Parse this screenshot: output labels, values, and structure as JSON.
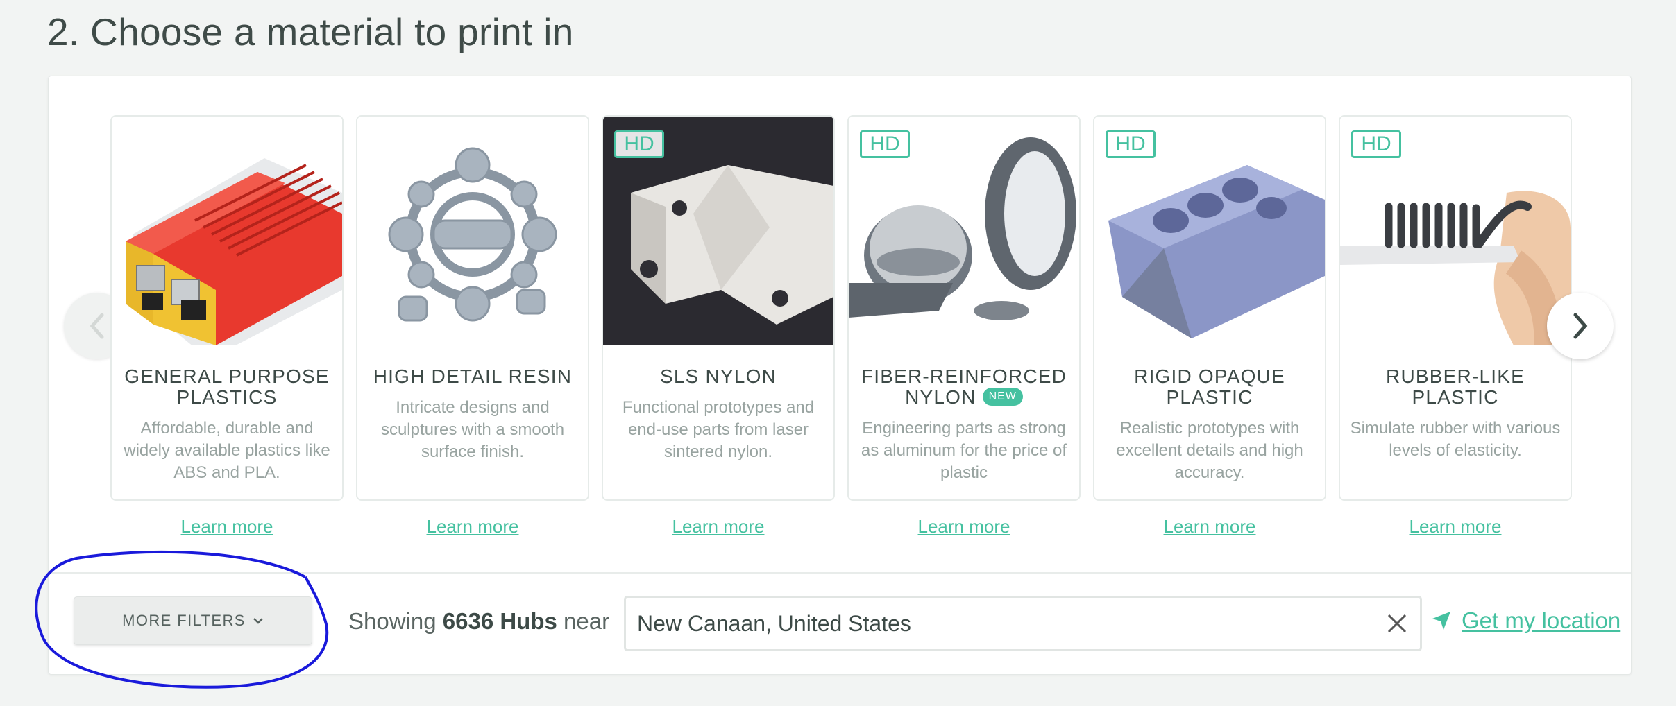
{
  "section": {
    "title": "2. Choose a material to print in"
  },
  "carousel": {
    "prev_icon": "chevron-left-icon",
    "next_icon": "chevron-right-icon",
    "materials": [
      {
        "name": "GENERAL PURPOSE PLASTICS",
        "hd": "",
        "is_new": false,
        "new_label": "",
        "description": "Affordable, durable and widely available plastics like ABS and PLA.",
        "link": "Learn more",
        "image": "red-plastic-case-image"
      },
      {
        "name": "HIGH DETAIL RESIN",
        "hd": "",
        "is_new": false,
        "new_label": "",
        "description": "Intricate designs and sculptures with a smooth surface finish.",
        "link": "Learn more",
        "image": "resin-gear-sculpture-image"
      },
      {
        "name": "SLS NYLON",
        "hd": "HD",
        "is_new": false,
        "new_label": "",
        "description": "Functional prototypes and end-use parts from laser sintered nylon.",
        "link": "Learn more",
        "image": "white-nylon-bracket-image"
      },
      {
        "name": "FIBER-REINFORCED NYLON",
        "hd": "HD",
        "is_new": true,
        "new_label": "NEW",
        "description": "Engineering parts as strong as aluminum for the price of plastic",
        "link": "Learn more",
        "image": "fiber-nylon-parts-image"
      },
      {
        "name": "RIGID OPAQUE PLASTIC",
        "hd": "HD",
        "is_new": false,
        "new_label": "",
        "description": "Realistic prototypes with excellent details and high accuracy.",
        "link": "Learn more",
        "image": "engine-block-image"
      },
      {
        "name": "RUBBER-LIKE PLASTIC",
        "hd": "HD",
        "is_new": false,
        "new_label": "",
        "description": "Simulate rubber with various levels of elasticity.",
        "link": "Learn more",
        "image": "rubber-brush-image"
      }
    ]
  },
  "filters": {
    "more_filters_label": "MORE FILTERS",
    "showing_prefix": "Showing",
    "hub_count": "6636 Hubs",
    "showing_suffix": "near",
    "location_value": "New Canaan, United States",
    "get_location_label": "Get my location"
  },
  "colors": {
    "accent": "#45c1a0",
    "annotation": "#1a1adb"
  }
}
